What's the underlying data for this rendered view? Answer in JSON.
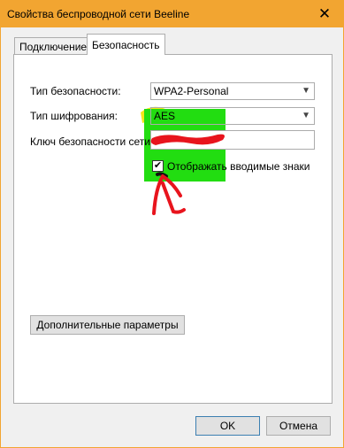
{
  "window": {
    "title": "Свойства беспроводной сети Beeline",
    "close_symbol": "✕"
  },
  "tabs": [
    {
      "label": "Подключение",
      "active": false
    },
    {
      "label": "Безопасность",
      "active": true
    }
  ],
  "form": {
    "security_type_label": "Тип безопасности:",
    "security_type_value": "WPA2-Personal",
    "encryption_type_label": "Тип шифрования:",
    "encryption_type_value": "AES",
    "key_label": "Ключ безопасности сети",
    "key_value": "",
    "show_chars_label": "Отображать вводимые знаки",
    "show_chars_checked": "✔",
    "advanced_button": "Дополнительные параметры"
  },
  "footer": {
    "ok_button": "OK",
    "cancel_button": "Отмена"
  },
  "colors": {
    "titlebar": "#f2a531",
    "highlight_green": "#22dd11",
    "highlight_yellow": "#f6e51a",
    "scribble_red": "#e8141d"
  }
}
